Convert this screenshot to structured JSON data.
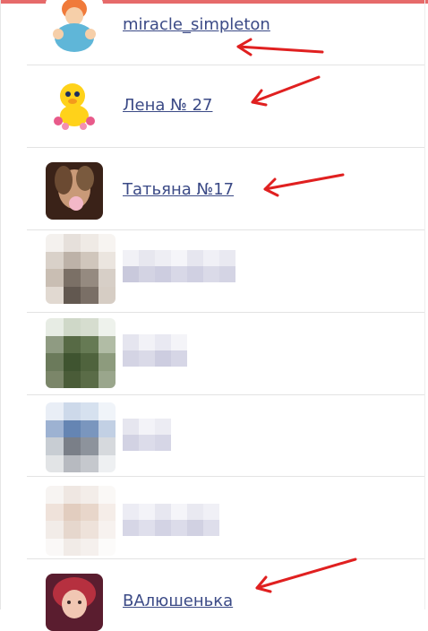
{
  "users": [
    {
      "name": "miracle_simpleton",
      "avatar_icon": "cartoon-lady-icon"
    },
    {
      "name": "Лена № 27",
      "avatar_icon": "yellow-chick-icon"
    },
    {
      "name": "Татьяна №17",
      "avatar_icon": "woman-photo-avatar"
    },
    {
      "name": "ВАлюшенька",
      "avatar_icon": "redhead-photo-avatar"
    }
  ],
  "blurred_rows": 4,
  "colors": {
    "accent_top": "#e66a6a",
    "link": "#3b4a86",
    "arrow": "#e02020",
    "divider": "#e3e3e3"
  }
}
